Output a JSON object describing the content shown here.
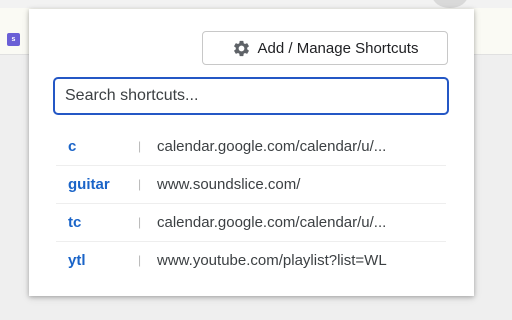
{
  "extension": {
    "favicon_letter": "s",
    "favicon_color": "#6a5fd6"
  },
  "popup": {
    "manage_button": {
      "icon": "gear-icon",
      "label": "Add / Manage Shortcuts"
    },
    "search": {
      "placeholder": "Search shortcuts...",
      "value": "",
      "focus_color": "#2457c5"
    },
    "shortcuts": [
      {
        "key": "c",
        "separator": "|",
        "url": "calendar.google.com/calendar/u/..."
      },
      {
        "key": "guitar",
        "separator": "|",
        "url": "www.soundslice.com/"
      },
      {
        "key": "tc",
        "separator": "|",
        "url": "calendar.google.com/calendar/u/..."
      },
      {
        "key": "ytl",
        "separator": "|",
        "url": "www.youtube.com/playlist?list=WL"
      }
    ],
    "key_color": "#1a64c8"
  }
}
